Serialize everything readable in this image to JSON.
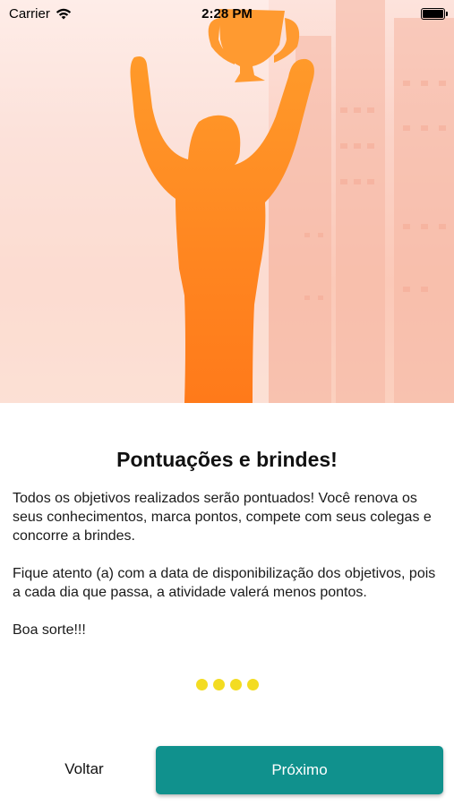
{
  "status_bar": {
    "carrier": "Carrier",
    "time": "2:28 PM",
    "icons": [
      "wifi-icon",
      "battery-icon"
    ]
  },
  "hero": {
    "image": "trophy-winner-illustration",
    "colors": {
      "figure": "#ff8a1e",
      "background": "#fbd2c6"
    }
  },
  "onboarding": {
    "title": "Pontuações e brindes!",
    "paragraphs": [
      "Todos os objetivos realizados serão pontuados! Você renova os seus conhecimentos, marca pontos, compete com seus colegas e concorre a brindes.",
      "Fique atento (a) com a data de disponibilização dos objetivos, pois a cada dia que passa, a atividade valerá menos pontos.",
      "Boa sorte!!!"
    ],
    "page_indicator": {
      "count": 4,
      "color": "#f3dc22"
    }
  },
  "actions": {
    "back_label": "Voltar",
    "next_label": "Próximo",
    "next_color": "#10918d"
  }
}
